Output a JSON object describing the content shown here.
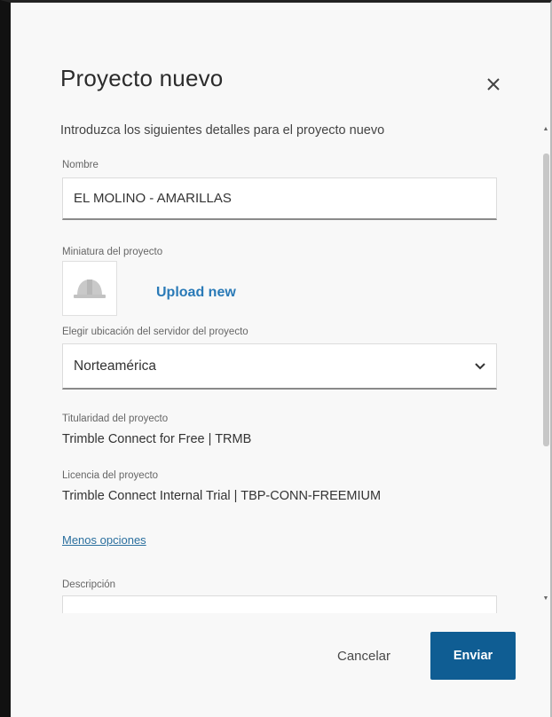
{
  "dialog": {
    "title": "Proyecto nuevo",
    "close_icon": "close-icon",
    "intro": "Introduzca los siguientes detalles para el proyecto nuevo"
  },
  "name_field": {
    "label": "Nombre",
    "value": "EL MOLINO - AMARILLAS"
  },
  "thumbnail": {
    "label": "Miniatura del proyecto",
    "icon": "hardhat-icon",
    "upload_label": "Upload new"
  },
  "server_location": {
    "label": "Elegir ubicación del servidor del proyecto",
    "selected": "Norteamérica",
    "icon": "chevron-down-icon"
  },
  "ownership": {
    "label": "Titularidad del proyecto",
    "value": "Trimble Connect for Free | TRMB"
  },
  "license": {
    "label": "Licencia del proyecto",
    "value": "Trimble Connect Internal Trial | TBP-CONN-FREEMIUM"
  },
  "less_options_label": "Menos opciones",
  "description": {
    "label": "Descripción"
  },
  "footer": {
    "cancel_label": "Cancelar",
    "submit_label": "Enviar"
  },
  "colors": {
    "accent": "#0f5d93",
    "link": "#2a7ab7"
  }
}
